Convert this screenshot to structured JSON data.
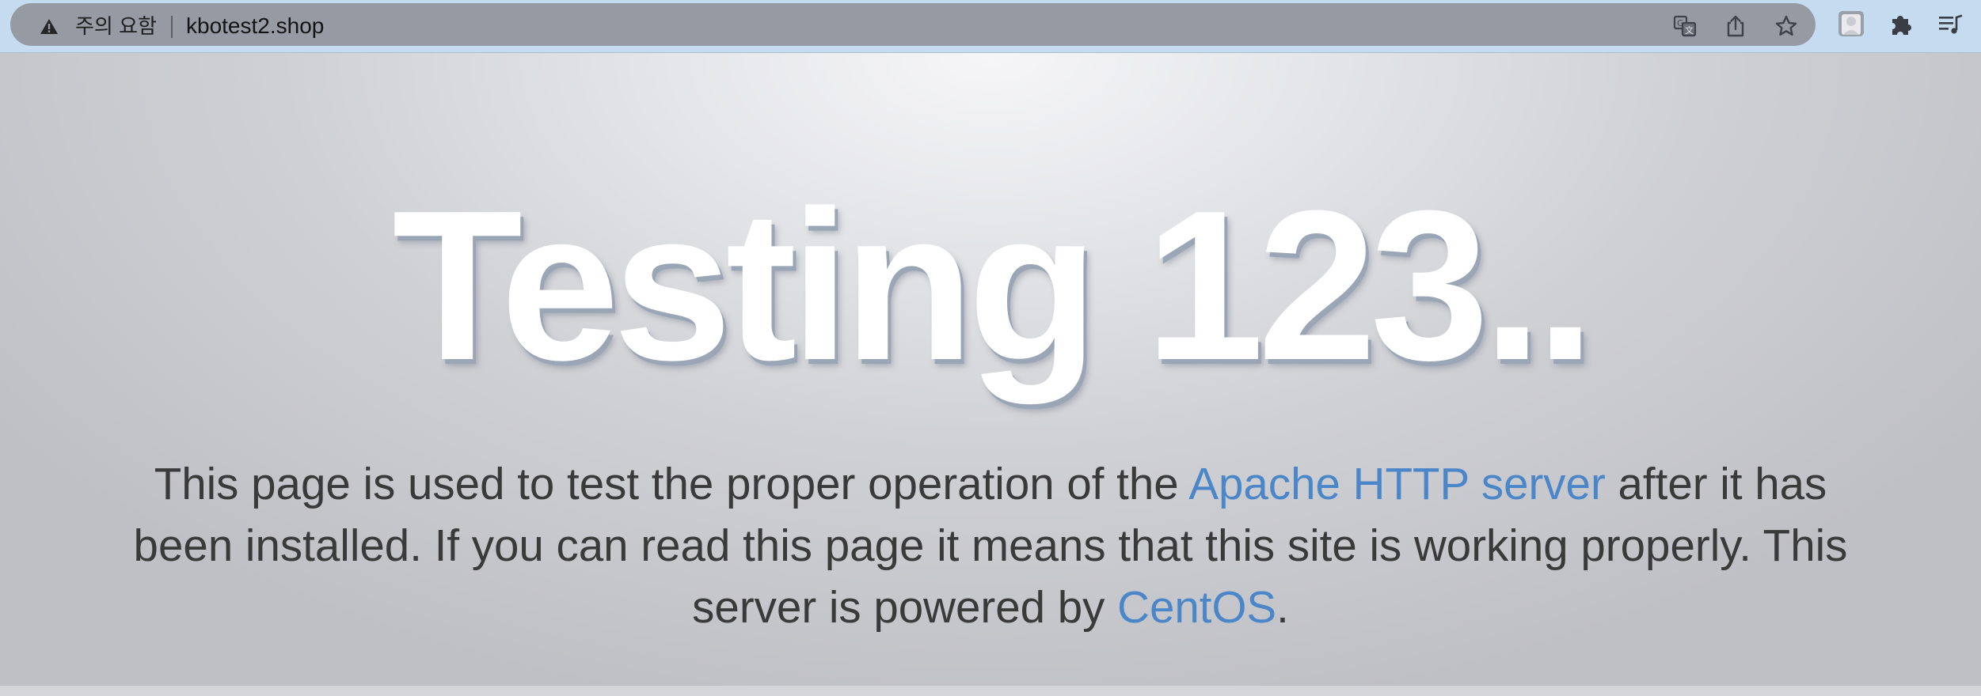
{
  "browser": {
    "security_label": "주의 요함",
    "url": "kbotest2.shop",
    "icons": {
      "warning": "warning-triangle-icon",
      "translate": "translate-icon",
      "share": "share-icon",
      "bookmark": "star-icon",
      "profile": "profile-avatar-icon",
      "extensions": "puzzle-icon",
      "reading_list": "reading-list-icon"
    }
  },
  "page": {
    "title": "Testing 123..",
    "lead_part1": "This page is used to test the proper operation of the ",
    "apache_link": "Apache HTTP server",
    "lead_part2": " after it has been installed. If you can read this page it means that this site is working properly. This server is powered by ",
    "centos_link": "CentOS",
    "lead_end": "."
  },
  "colors": {
    "link": "#4a86c8",
    "omnibox": "#969aa3",
    "browser_bar": "#c5dbef",
    "title": "#ffffff",
    "text": "#3a3a3a"
  }
}
